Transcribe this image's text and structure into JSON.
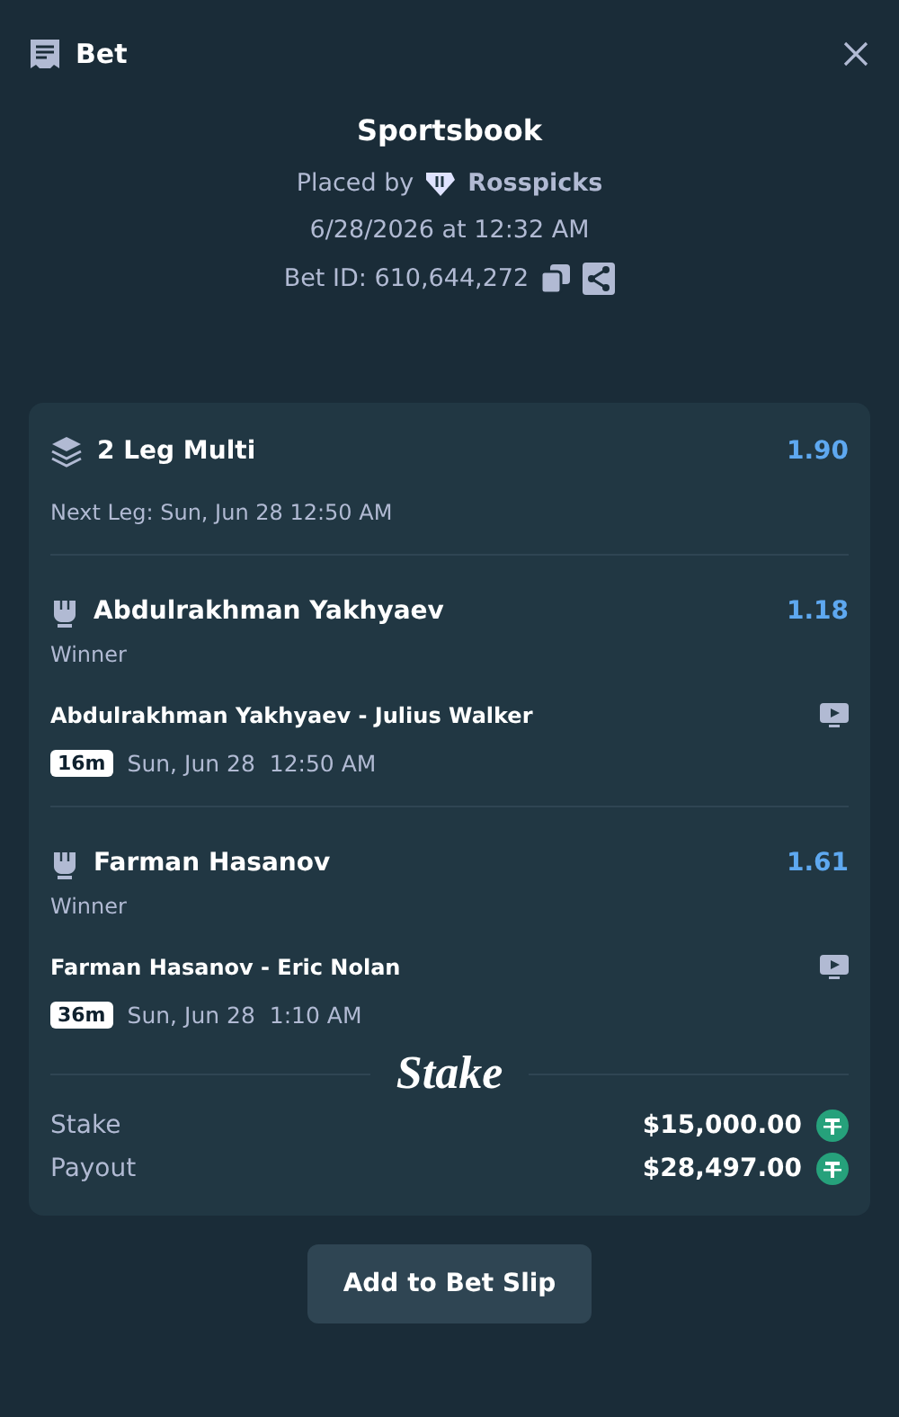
{
  "header": {
    "title": "Bet"
  },
  "summary": {
    "title": "Sportsbook",
    "placed_by_label": "Placed by",
    "user": "Rosspicks",
    "datetime": "6/28/2026 at 12:32 AM",
    "bet_id": "Bet ID: 610,644,272"
  },
  "multi": {
    "title": "2 Leg Multi",
    "odds": "1.90",
    "next_leg": "Next Leg: Sun, Jun 28 12:50 AM"
  },
  "legs": [
    {
      "selection": "Abdulrakhman Yakhyaev",
      "odds": "1.18",
      "market": "Winner",
      "event": "Abdulrakhman Yakhyaev - Julius Walker",
      "countdown": "16m",
      "date": "Sun, Jun 28",
      "time": "12:50 AM"
    },
    {
      "selection": "Farman Hasanov",
      "odds": "1.61",
      "market": "Winner",
      "event": "Farman Hasanov - Eric Nolan",
      "countdown": "36m",
      "date": "Sun, Jun 28",
      "time": "1:10 AM"
    }
  ],
  "brand": "Stake",
  "totals": [
    {
      "label": "Stake",
      "amount": "$15,000.00"
    },
    {
      "label": "Payout",
      "amount": "$28,497.00"
    }
  ],
  "action": "Add to Bet Slip"
}
